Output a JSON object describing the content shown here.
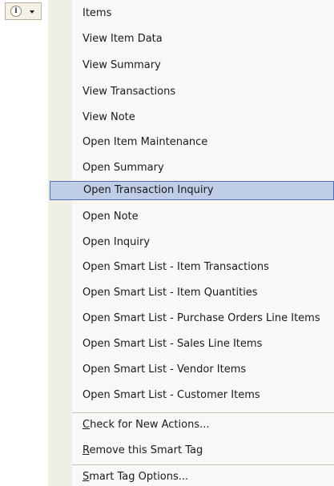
{
  "smart_tag_button": {
    "info_glyph": "i",
    "icon": "info-icon",
    "dropdown_icon": "chevron-down-icon"
  },
  "menu": {
    "header": "Items",
    "items": [
      {
        "label": "View Item Data"
      },
      {
        "label": "View Summary"
      },
      {
        "label": "View Transactions"
      },
      {
        "label": "View Note"
      },
      {
        "label": "Open Item Maintenance"
      },
      {
        "label": "Open Summary"
      },
      {
        "label": "Open Transaction Inquiry",
        "selected": true
      },
      {
        "label": "Open Note"
      },
      {
        "label": "Open Inquiry"
      },
      {
        "label": "Open Smart List - Item Transactions"
      },
      {
        "label": "Open Smart List - Item Quantities"
      },
      {
        "label": "Open Smart List - Purchase Orders Line Items"
      },
      {
        "label": "Open Smart List - Sales Line Items"
      },
      {
        "label": "Open Smart List - Vendor Items"
      },
      {
        "label": "Open Smart List - Customer Items"
      }
    ],
    "actions": [
      {
        "accel": "C",
        "rest": "heck for New Actions..."
      },
      {
        "accel": "R",
        "rest": "emove this Smart Tag"
      }
    ],
    "options": [
      {
        "accel": "S",
        "rest": "mart Tag Options..."
      }
    ]
  },
  "colors": {
    "selection_fill": "#c0cde7",
    "selection_border": "#4f6fb0",
    "gutter": "#efefe5",
    "menu_background": "#f9f8f6"
  }
}
